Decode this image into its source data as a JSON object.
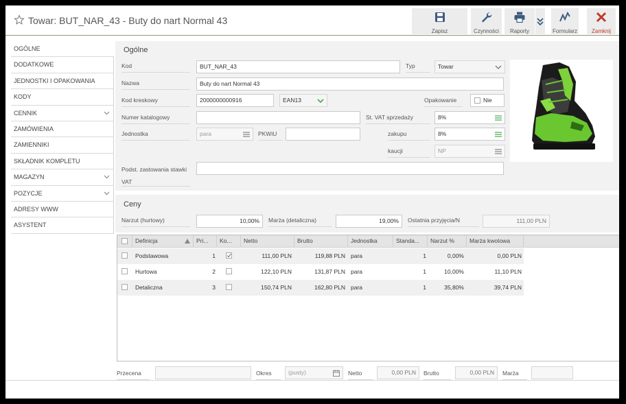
{
  "header": {
    "title": "Towar: BUT_NAR_43 - Buty do nart Normal 43",
    "toolbar": {
      "save": "Zapisz",
      "actions": "Czynności",
      "reports": "Raporty",
      "form": "Formularz",
      "close": "Zamknij"
    }
  },
  "nav": {
    "items": [
      {
        "label": "OGÓLNE"
      },
      {
        "label": "DODATKOWE"
      },
      {
        "label": "JEDNOSTKI I OPAKOWANIA"
      },
      {
        "label": "KODY"
      },
      {
        "label": "CENNIK"
      },
      {
        "label": "ZAMÓWIENIA"
      },
      {
        "label": "ZAMIENNIKI"
      },
      {
        "label": "SKŁADNIK KOMPLETU"
      },
      {
        "label": "MAGAZYN"
      },
      {
        "label": "POZYCJE"
      },
      {
        "label": "ADRESY WWW"
      },
      {
        "label": "ASYSTENT"
      }
    ]
  },
  "general": {
    "section_title": "Ogólne",
    "kod_label": "Kod",
    "kod_value": "BUT_NAR_43",
    "typ_label": "Typ",
    "typ_value": "Towar",
    "nazwa_label": "Nazwa",
    "nazwa_value": "Buty do nart Normal 43",
    "kod_kreskowy_label": "Kod kreskowy",
    "kod_kreskowy_value": "2000000000916",
    "kod_kreskowy_type": "EAN13",
    "opakowanie_label": "Opakowanie",
    "opakowanie_value": "Nie",
    "numer_katalogowy_label": "Numer katalogowy",
    "numer_katalogowy_value": "",
    "vat_sprzedazy_label": "St. VAT sprzedaży",
    "vat_sprzedazy_value": "8%",
    "jednostka_label": "Jednostka",
    "jednostka_value": "para",
    "pkwiu_label": "PKWiU",
    "pkwiu_value": "",
    "zakupu_label": "zakupu",
    "zakupu_value": "8%",
    "kaucji_label": "kaucji",
    "kaucji_value": "NP",
    "podstawa_label_1": "Podst. zastowania stawki",
    "podstawa_label_2": "VAT",
    "podstawa_value": ""
  },
  "prices": {
    "section_title": "Ceny",
    "narzut_label": "Narzut (hurtowy)",
    "narzut_value": "10,00%",
    "marza_label": "Marża (detaliczna)",
    "marza_value": "19,00%",
    "ostatnia_label": "Ostatnia przyjęcia/N",
    "ostatnia_value": "111,00 PLN"
  },
  "grid": {
    "columns": [
      "Definicja",
      "Pri...",
      "Ko...",
      "Netto",
      "Brutto",
      "Jednostka",
      "Standa...",
      "Narzut %",
      "Marża kwotowa"
    ],
    "rows": [
      {
        "definicja": "Podstawowa",
        "pri": "1",
        "ko": true,
        "netto": "111,00 PLN",
        "brutto": "119,88 PLN",
        "jednostka": "para",
        "standa": "1",
        "narzut": "0,00%",
        "marza": "0,00 PLN"
      },
      {
        "definicja": "Hurtowa",
        "pri": "2",
        "ko": false,
        "netto": "122,10 PLN",
        "brutto": "131,87 PLN",
        "jednostka": "para",
        "standa": "1",
        "narzut": "10,00%",
        "marza": "11,10 PLN"
      },
      {
        "definicja": "Detaliczna",
        "pri": "3",
        "ko": false,
        "netto": "150,74 PLN",
        "brutto": "162,80 PLN",
        "jednostka": "para",
        "standa": "1",
        "narzut": "35,80%",
        "marza": "39,74 PLN"
      }
    ]
  },
  "footer": {
    "przecena_label": "Przecena",
    "przecena_value": "",
    "okres_label": "Okres",
    "okres_value": "(pusty)",
    "netto_label": "Netto",
    "netto_value": "0,00 PLN",
    "brutto_label": "Brutto",
    "brutto_value": "0,00 PLN",
    "marza_label": "Marża",
    "marza_value": ""
  },
  "colors": {
    "accent_green": "#4caf50",
    "close_red": "#c0392b",
    "icon_blue": "#3d5a80"
  }
}
